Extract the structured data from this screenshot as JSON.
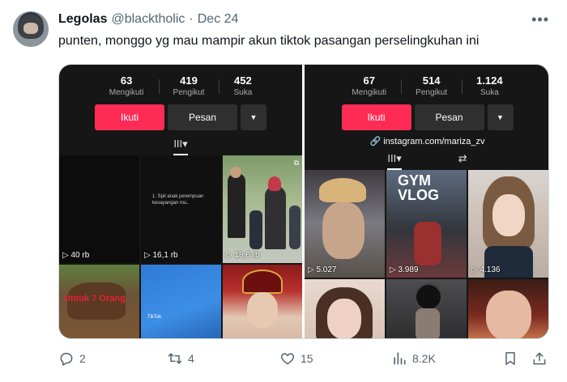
{
  "tweet": {
    "author_name": "Legolas",
    "author_handle": "@blacktholic",
    "separator": "·",
    "date": "Dec 24",
    "more_icon": "more-horizontal-icon",
    "text": "punten, monggo yg mau mampir akun tiktok pasangan perselingkuhan ini"
  },
  "left_profile": {
    "stats": [
      {
        "value": "63",
        "label": "Mengikuti"
      },
      {
        "value": "419",
        "label": "Pengikut"
      },
      {
        "value": "452",
        "label": "Suka"
      }
    ],
    "follow_label": "Ikuti",
    "message_label": "Pesan",
    "dropdown_icon": "▼",
    "tab_icon": "III▾",
    "videos": [
      {
        "views": "40 rb"
      },
      {
        "views": "16,1 rb",
        "caption": "1. Spil anak perempuan kesayangan mu.."
      },
      {
        "views": "18,6 rb"
      },
      {
        "overlay_text": "Untuk 7 Orang"
      },
      {
        "overlay_text": "TikTok"
      },
      {
        "views": ""
      }
    ]
  },
  "right_profile": {
    "stats": [
      {
        "value": "67",
        "label": "Mengikuti"
      },
      {
        "value": "514",
        "label": "Pengikut"
      },
      {
        "value": "1.124",
        "label": "Suka"
      }
    ],
    "follow_label": "Ikuti",
    "message_label": "Pesan",
    "dropdown_icon": "▼",
    "link": "instagram.com/mariza_zv",
    "tab_icon": "III▾",
    "repost_icon": "⇄",
    "videos": [
      {
        "views": "5.027"
      },
      {
        "views": "3.989",
        "overlay_text": "GYM VLOG"
      },
      {
        "views": "4.136"
      },
      {
        "views": ""
      },
      {
        "views": ""
      },
      {
        "views": ""
      }
    ]
  },
  "actions": {
    "reply_count": "2",
    "retweet_count": "4",
    "like_count": "15",
    "view_count": "8.2K"
  }
}
